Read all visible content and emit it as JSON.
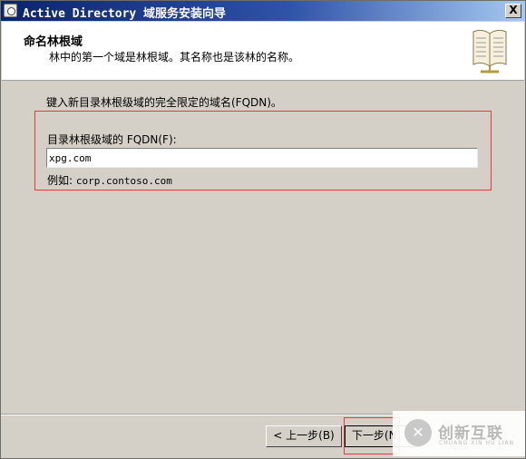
{
  "window": {
    "title": "Active Directory 域服务安装向导",
    "close_glyph": "X"
  },
  "header": {
    "title": "命名林根域",
    "subtitle": "林中的第一个域是林根域。其名称也是该林的名称。",
    "icon": "book-icon"
  },
  "main": {
    "intro": "键入新目录林根级域的完全限定的域名(FQDN)。",
    "fqdn_label": "目录林根级域的 FQDN(F):",
    "fqdn_value": "xpg.com",
    "example_label": "例如:",
    "example_value": "corp.contoso.com"
  },
  "buttons": {
    "back": "< 上一步(B)",
    "next": "下一步(N) >"
  },
  "watermark": {
    "brand": "创新互联",
    "sub": "CHUANG XIN HU LIAN"
  },
  "colors": {
    "titlebar_start": "#0a246a",
    "titlebar_end": "#a6caf0",
    "dialog_bg": "#d4d0c8",
    "highlight": "#e83a3a"
  }
}
